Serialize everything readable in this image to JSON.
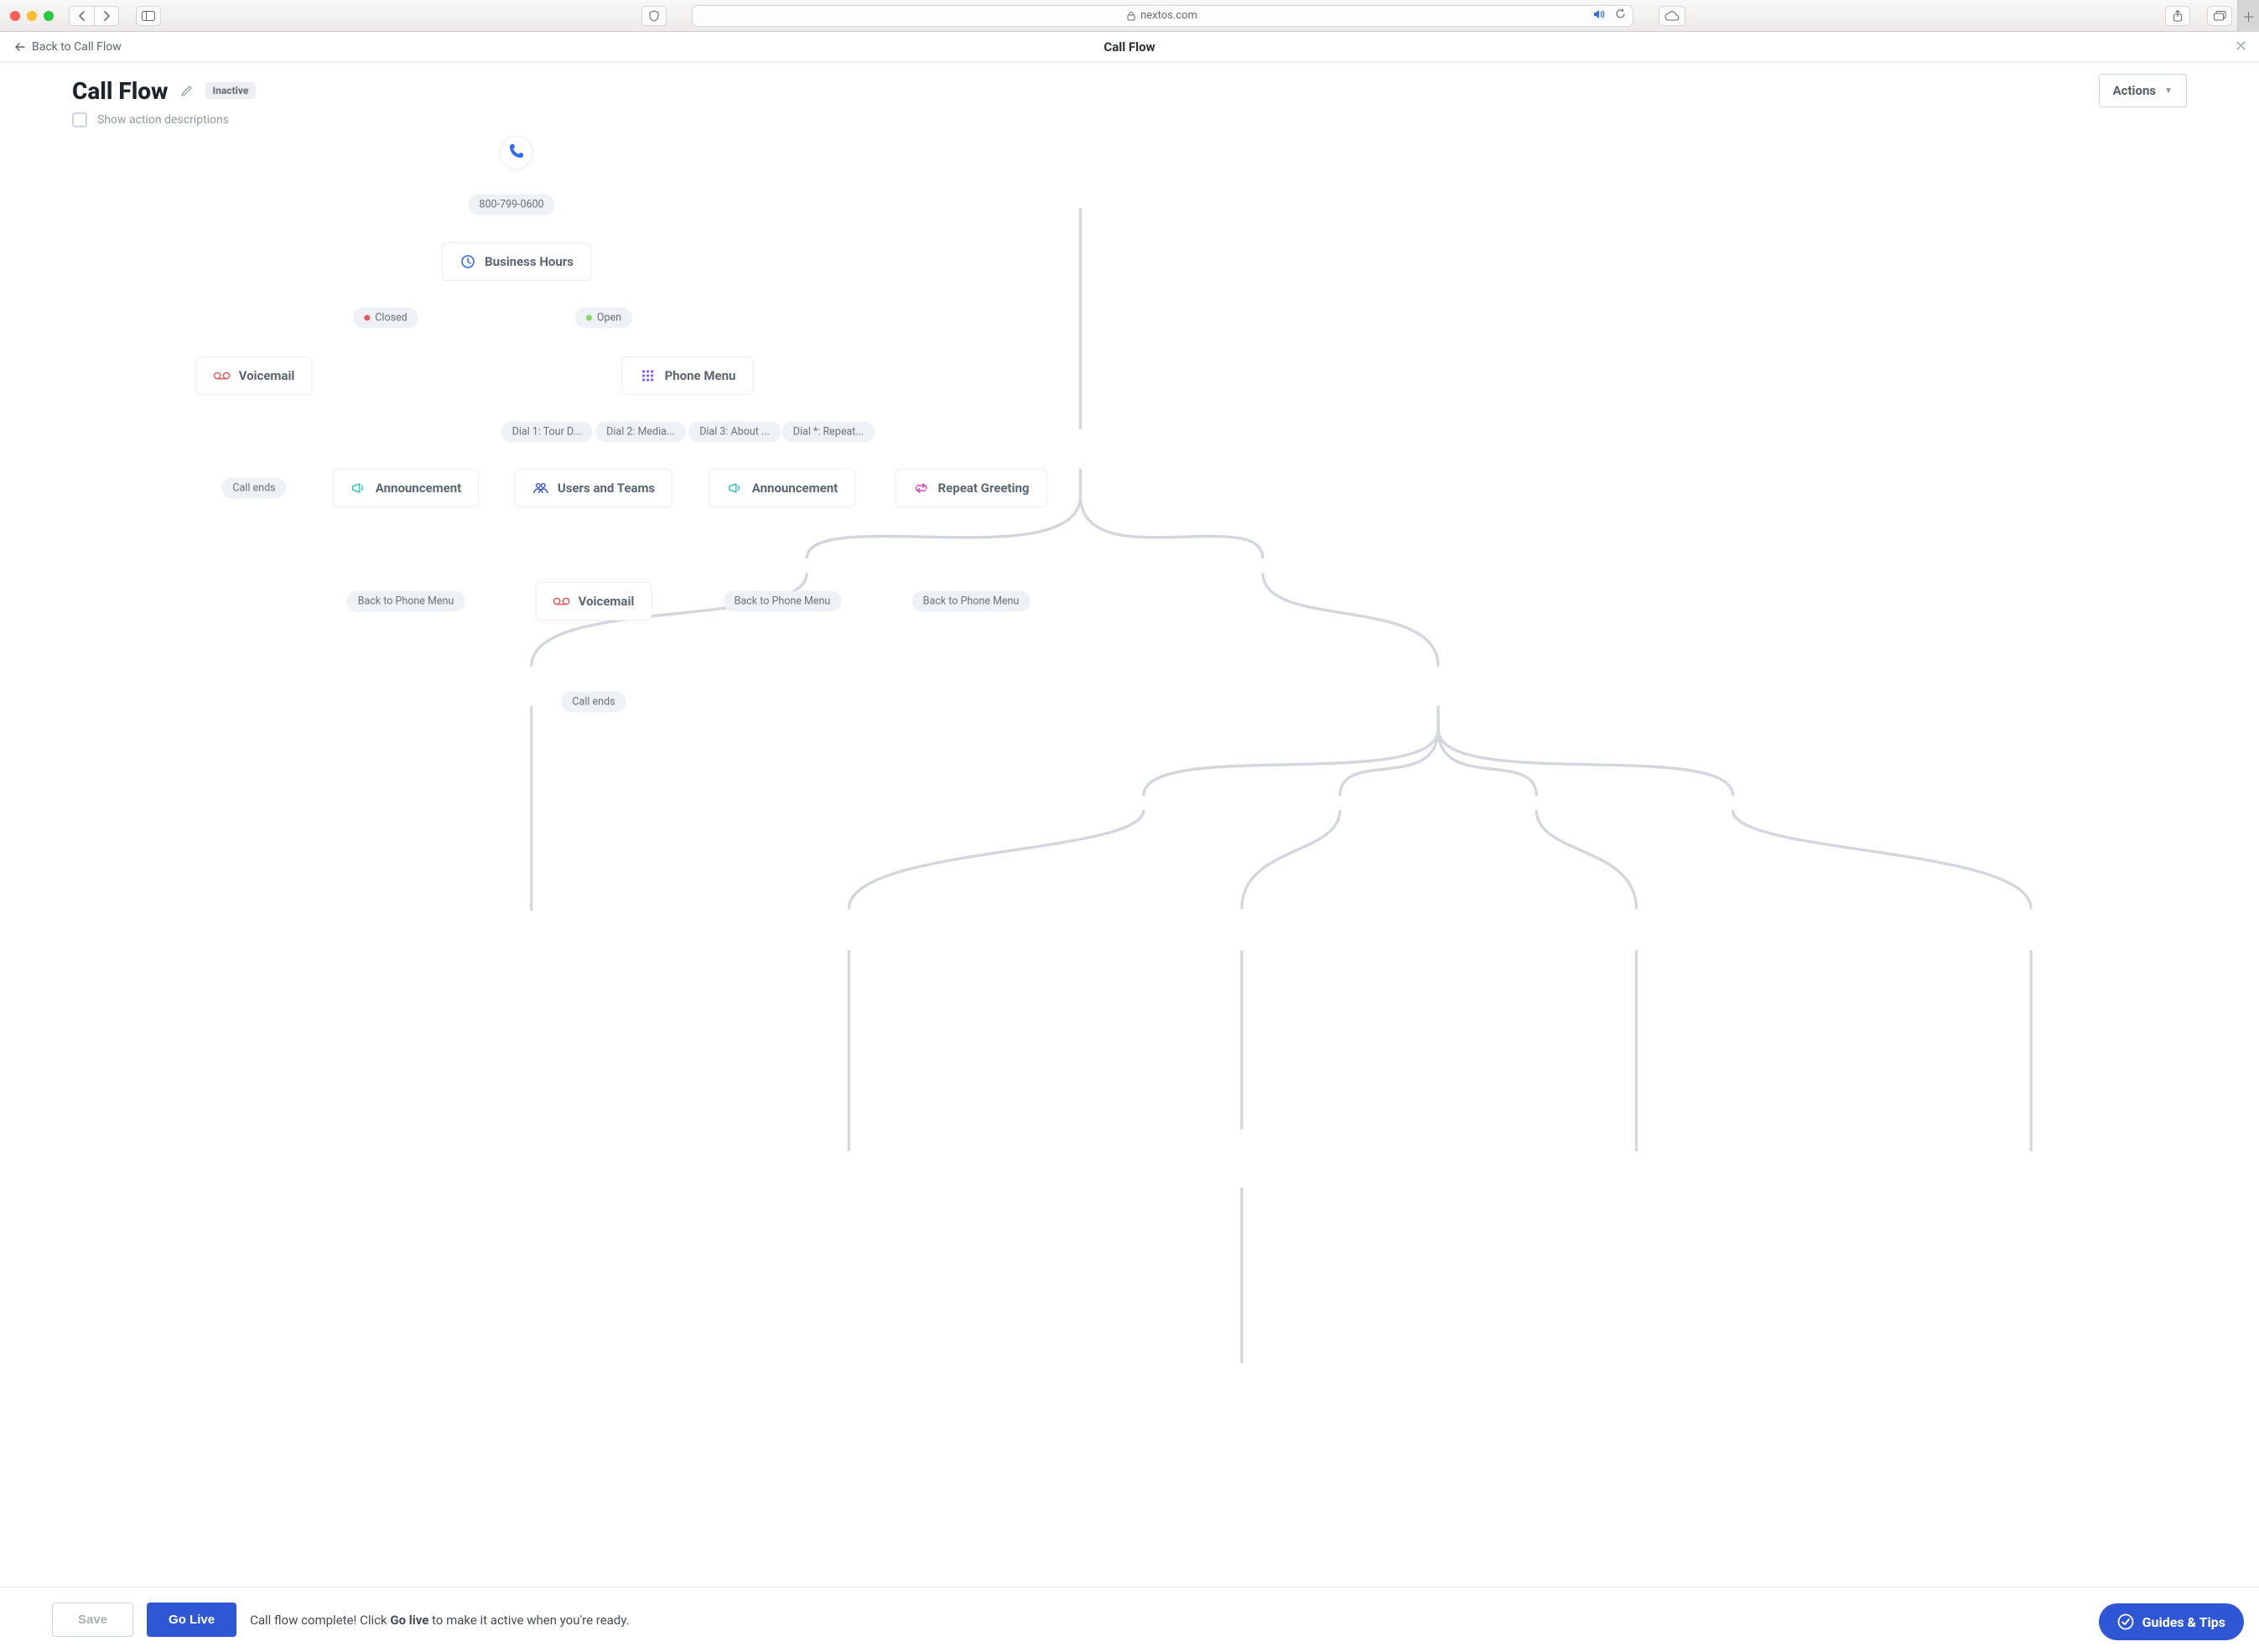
{
  "browser": {
    "url_domain": "nextos.com"
  },
  "sub_header": {
    "back_label": "Back to Call Flow",
    "title": "Call Flow"
  },
  "header": {
    "title": "Call Flow",
    "status_badge": "Inactive",
    "actions_label": "Actions",
    "show_desc_label": "Show action descriptions"
  },
  "flow": {
    "phone_number": "800-799-0600",
    "business_hours": "Business Hours",
    "closed_label": "Closed",
    "open_label": "Open",
    "voicemail": "Voicemail",
    "phone_menu": "Phone Menu",
    "dial1": "Dial 1: Tour D...",
    "dial2": "Dial 2: Media...",
    "dial3": "Dial 3: About ...",
    "dial_star": "Dial *: Repeat...",
    "announcement": "Announcement",
    "users_teams": "Users and Teams",
    "repeat_greeting": "Repeat Greeting",
    "voicemail2": "Voicemail",
    "call_ends": "Call ends",
    "back_to_phone_menu": "Back to Phone Menu"
  },
  "footer": {
    "save": "Save",
    "go_live": "Go Live",
    "msg_pre": "Call flow complete! Click ",
    "msg_bold": "Go live",
    "msg_post": " to make it active when you're ready.",
    "guides": "Guides & Tips"
  }
}
